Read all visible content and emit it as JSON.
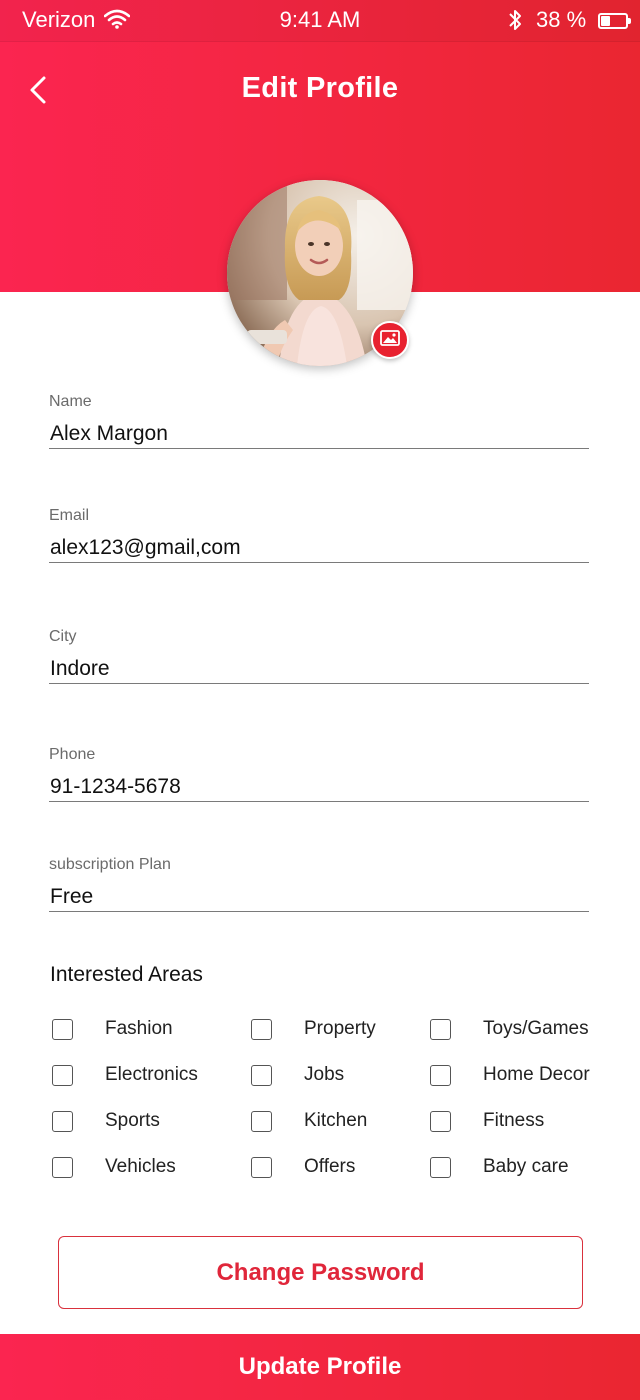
{
  "status_bar": {
    "carrier": "Verizon",
    "time": "9:41 AM",
    "battery": "38 %",
    "battery_level": 0.38
  },
  "header": {
    "title": "Edit Profile",
    "back_icon": "chevron-left-icon",
    "background_gradient": [
      "#fb2550",
      "#ea2631"
    ]
  },
  "profile": {
    "avatar_icon": "profile-photo",
    "photo_button_icon": "image-icon"
  },
  "form": {
    "name": {
      "label": "Name",
      "value": "Alex Margon"
    },
    "email": {
      "label": "Email",
      "value": "alex123@gmail,com"
    },
    "city": {
      "label": "City",
      "value": "Indore"
    },
    "phone": {
      "label": "Phone",
      "value": "91-1234-5678"
    },
    "plan": {
      "label": "subscription Plan",
      "value": "Free"
    }
  },
  "interested_areas": {
    "title": "Interested Areas",
    "items": [
      {
        "label": "Fashion",
        "checked": false
      },
      {
        "label": "Property",
        "checked": false
      },
      {
        "label": "Toys/Games",
        "checked": false
      },
      {
        "label": "Electronics",
        "checked": false
      },
      {
        "label": "Jobs",
        "checked": false
      },
      {
        "label": "Home Decor",
        "checked": false
      },
      {
        "label": "Sports",
        "checked": false
      },
      {
        "label": "Kitchen",
        "checked": false
      },
      {
        "label": "Fitness",
        "checked": false
      },
      {
        "label": "Vehicles",
        "checked": false
      },
      {
        "label": "Offers",
        "checked": false
      },
      {
        "label": "Baby care",
        "checked": false
      }
    ]
  },
  "buttons": {
    "change_password": "Change Password",
    "update_profile": "Update Profile"
  },
  "colors": {
    "accent": "#e8212f",
    "text": "#111111",
    "label": "#6b6b6b"
  }
}
